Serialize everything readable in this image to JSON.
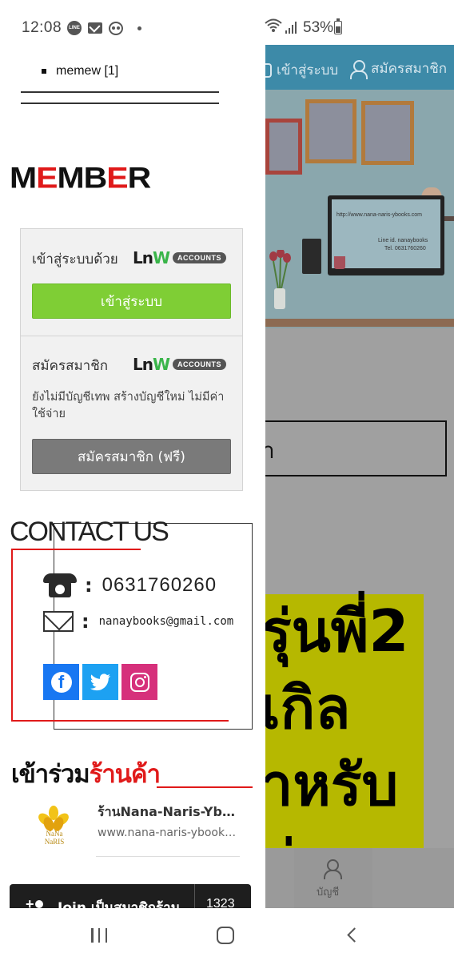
{
  "status_bar": {
    "time": "12:08",
    "battery": "53%",
    "notifications": [
      "line-icon",
      "gmail-icon",
      "panda-icon",
      "dot-icon"
    ],
    "line_label": "LINE"
  },
  "drawer": {
    "list_item": "memew [1]",
    "member_logo": {
      "part1": "M",
      "part2": "E",
      "part3": "MB",
      "part4": "E",
      "part5": "R"
    },
    "login_box": {
      "login_title": "เข้าสู่ระบบด้วย",
      "lnw_brand": {
        "prefix": "Ln",
        "suffix": "W",
        "pill": "ACCOUNTS"
      },
      "login_button": "เข้าสู่ระบบ",
      "register_title": "สมัครสมาชิก",
      "register_desc": "ยังไม่มีบัญชีเทพ สร้างบัญชีใหม่ ไม่มีค่าใช้จ่าย",
      "register_button": "สมัครสมาชิก (ฟรี)"
    },
    "contact": {
      "title": "CONTACT US",
      "phone": "0631760260",
      "email": "nanaybooks@gmail.com",
      "colon": ":"
    },
    "join": {
      "title_part1": "เข้าร่วม",
      "title_part2": "ร้านค้า",
      "shop_logo_text_1": "NaNa",
      "shop_logo_text_2": "NaRIS",
      "shop_name": "ร้านNana-Naris-Ybooks",
      "shop_url": "www.nana-naris-ybooks.com",
      "join_label": "Join เป็นสมาชิกร้าน",
      "join_count": "1323"
    }
  },
  "background_page": {
    "login_link": "เข้าสู่ระบบ",
    "register_link": "สมัครสมาชิก",
    "banner_url": "http://www.nana-naris-ybooks.com",
    "banner_line": "Line id. nanaybooks",
    "banner_tel": "Tel. 0631760260",
    "search_fragment": "า",
    "promo_line1": "รุ่นพี่2",
    "promo_line2": "เกิล",
    "promo_line3": "าหรับ",
    "promo_line4": "ก่น",
    "account_label": "บัญชี"
  },
  "colors": {
    "brand_red": "#e01a1a",
    "login_green": "#7fce35",
    "register_gray": "#7a7a7a",
    "header_blue": "#3d8aa8",
    "facebook": "#1877f2",
    "twitter": "#1da1f2",
    "instagram": "#d6307b",
    "promo_yellow": "#b6b800"
  }
}
